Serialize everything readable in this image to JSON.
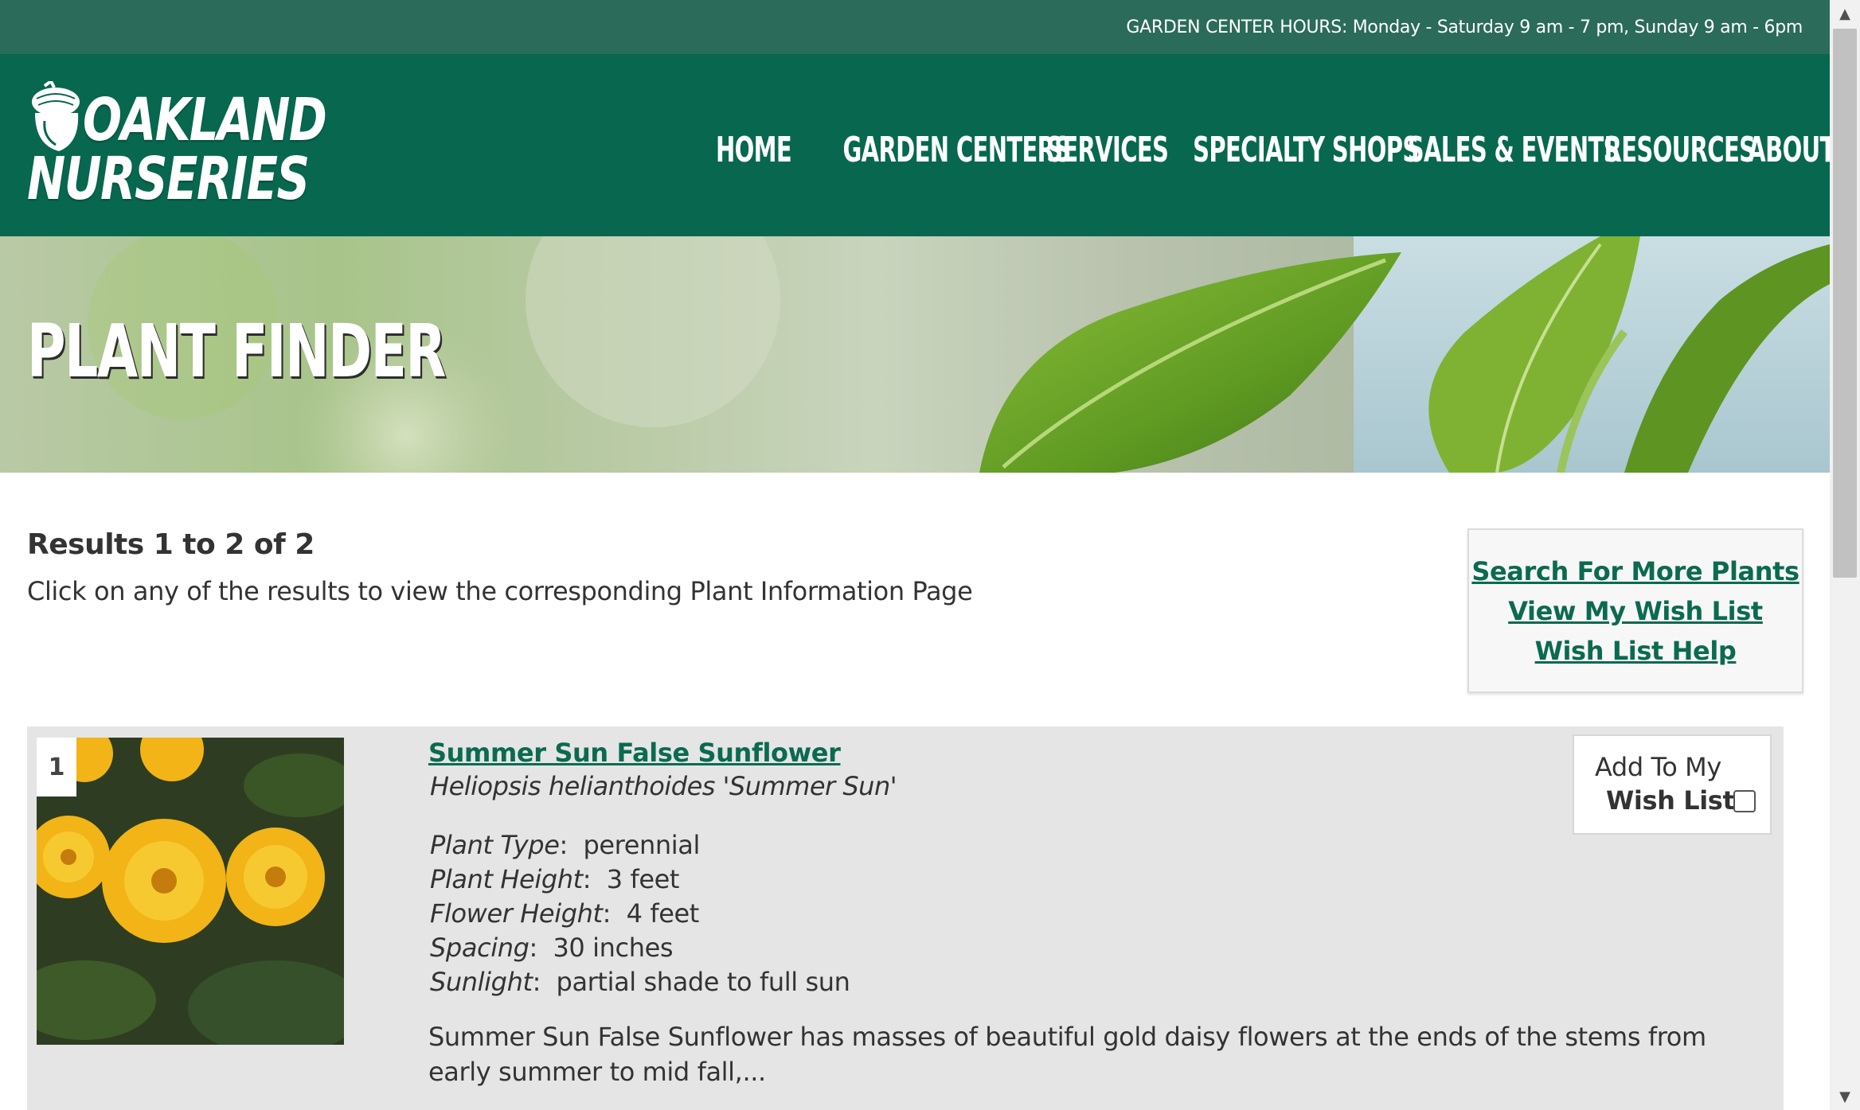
{
  "hours_bar": {
    "text": "GARDEN CENTER HOURS: Monday - Saturday 9 am - 7 pm, Sunday 9 am - 6pm"
  },
  "header": {
    "logo": {
      "line1": "OAKLAND",
      "line2": "NURSERIES"
    },
    "nav": [
      "HOME",
      "GARDEN CENTERS",
      "SERVICES",
      "SPECIALTY SHOPS",
      "SALES & EVENTS",
      "RESOURCES",
      "ABOUT"
    ]
  },
  "hero": {
    "title": "PLANT FINDER"
  },
  "results": {
    "heading": "Results 1 to 2 of 2",
    "subtitle": "Click on any of the results to view the corresponding Plant Information Page"
  },
  "sidebar_links": [
    "Search For More Plants",
    "View My Wish List",
    "Wish List Help"
  ],
  "result_items": [
    {
      "number": "1",
      "name": "Summer Sun False Sunflower",
      "latin": "Heliopsis helianthoides 'Summer Sun'",
      "attributes": [
        {
          "label": "Plant Type",
          "value": "perennial"
        },
        {
          "label": "Plant Height",
          "value": "3 feet"
        },
        {
          "label": "Flower Height",
          "value": "4 feet"
        },
        {
          "label": "Spacing",
          "value": "30 inches"
        },
        {
          "label": "Sunlight",
          "value": "partial shade to full sun"
        }
      ],
      "description": "Summer Sun False Sunflower has masses of beautiful gold daisy flowers at the ends of the stems from early summer to mid fall,...",
      "wishlist": {
        "line1": "Add To My",
        "line2": "Wish List",
        "checked": false
      }
    }
  ],
  "colors": {
    "hours_bar": "#2b6b59",
    "header": "#07684f",
    "link": "#0b6a50",
    "card_bg": "#e5e5e5"
  }
}
